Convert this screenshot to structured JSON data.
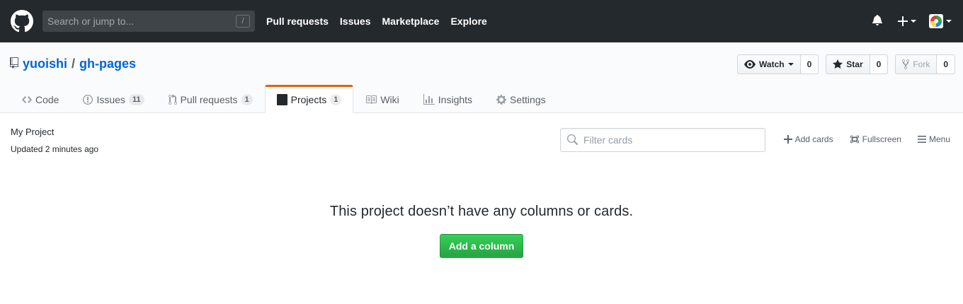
{
  "header": {
    "search_placeholder": "Search or jump to...",
    "search_key": "/",
    "nav": [
      "Pull requests",
      "Issues",
      "Marketplace",
      "Explore"
    ]
  },
  "repo": {
    "owner": "yuoishi",
    "separator": "/",
    "name": "gh-pages",
    "watch_label": "Watch",
    "watch_count": "0",
    "star_label": "Star",
    "star_count": "0",
    "fork_label": "Fork",
    "fork_count": "0"
  },
  "reponav": {
    "code": "Code",
    "issues": "Issues",
    "issues_count": "11",
    "pulls": "Pull requests",
    "pulls_count": "1",
    "projects": "Projects",
    "projects_count": "1",
    "wiki": "Wiki",
    "insights": "Insights",
    "settings": "Settings"
  },
  "project": {
    "name": "My Project",
    "updated": "Updated 2 minutes ago",
    "filter_placeholder": "Filter cards",
    "add_cards": "Add cards",
    "fullscreen": "Fullscreen",
    "menu": "Menu"
  },
  "blank_state": {
    "message": "This project doesn’t have any columns or cards.",
    "button": "Add a column"
  },
  "colors": {
    "header_bg": "#24292e",
    "link_blue": "#0366d6",
    "selected_tab_accent": "#e36209",
    "primary_green": "#28a745"
  }
}
